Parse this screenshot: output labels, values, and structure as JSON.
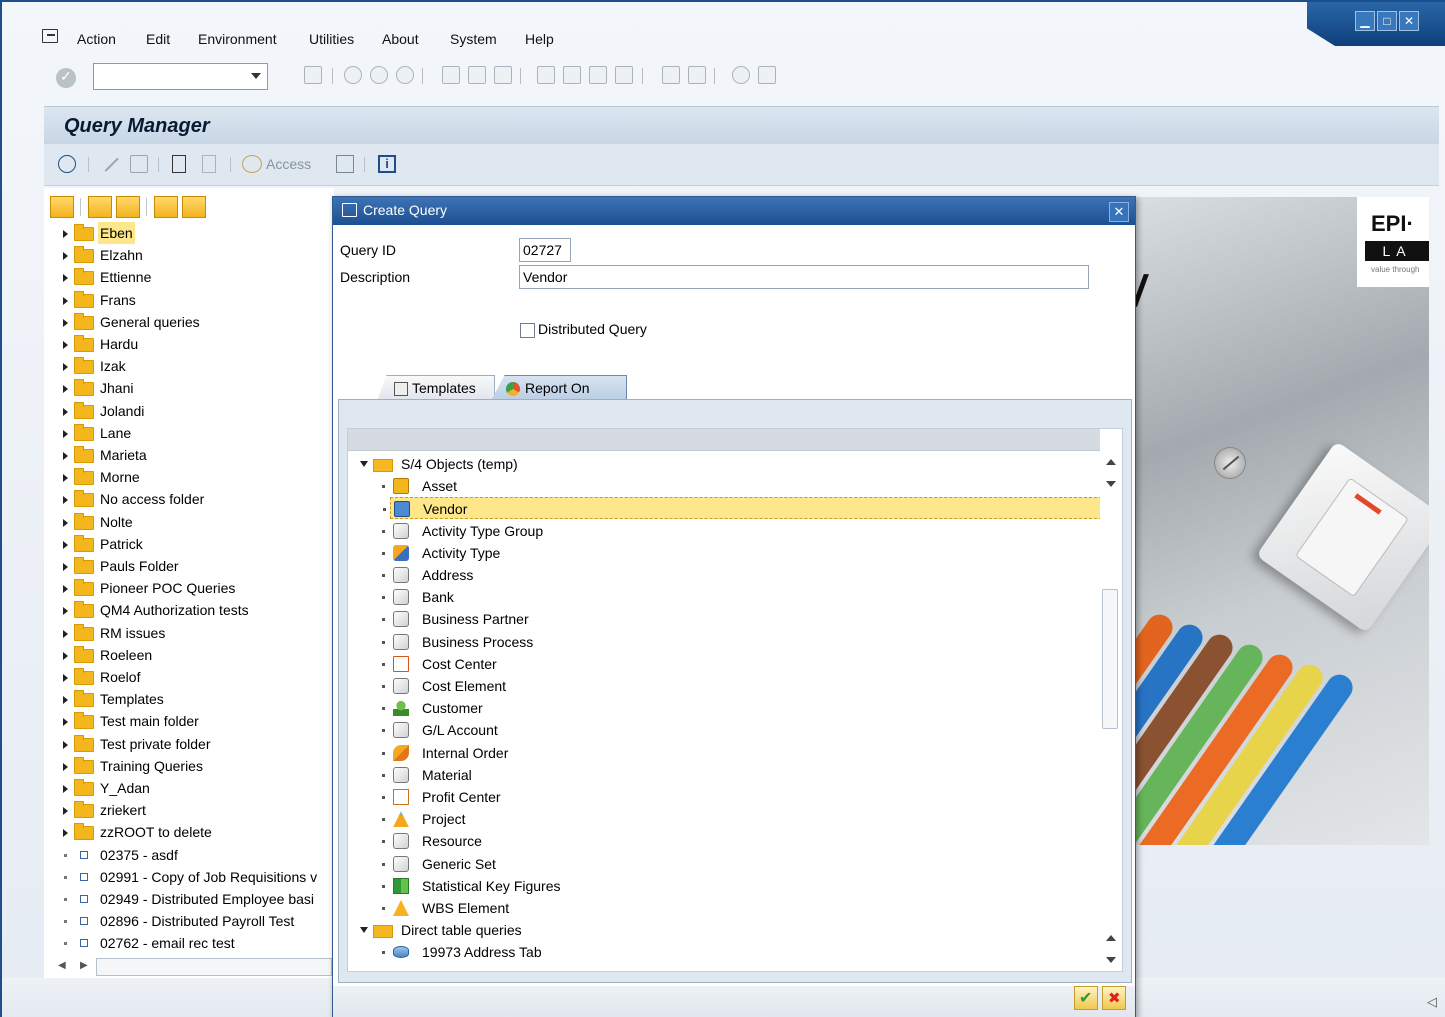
{
  "menubar": {
    "items": [
      "Action",
      "Edit",
      "Environment",
      "Utilities",
      "About",
      "System",
      "Help"
    ]
  },
  "window_controls": [
    "minimize-icon",
    "maximize-icon",
    "close-icon"
  ],
  "query_manager": {
    "title": "Query Manager",
    "toolbar": {
      "access_label": "Access"
    }
  },
  "left_tree": {
    "folders": [
      "Eben",
      "Elzahn",
      "Ettienne",
      "Frans",
      "General queries",
      "Hardu",
      "Izak",
      "Jhani",
      "Jolandi",
      "Lane",
      "Marieta",
      "Morne",
      "No access folder",
      "Nolte",
      "Patrick",
      "Pauls Folder",
      "Pioneer POC Queries",
      "QM4 Authorization tests",
      "RM issues",
      "Roeleen",
      "Roelof",
      "Templates",
      "Test main folder",
      "Test private folder",
      "Training Queries",
      "Y_Adan",
      "zriekert",
      "zzROOT to delete"
    ],
    "queries": [
      "02375 - asdf",
      "02991 - Copy of Job Requisitions v",
      "02949 - Distributed Employee basi",
      "02896 - Distributed Payroll Test",
      "02762 - email rec test"
    ],
    "selected": "Eben"
  },
  "dialog": {
    "title": "Create Query",
    "query_id_label": "Query ID",
    "query_id_value": "02727",
    "description_label": "Description",
    "description_value": "Vendor",
    "distributed_label": "Distributed Query",
    "distributed_checked": false,
    "tabs": [
      {
        "label": "Templates",
        "icon": "templates-icon"
      },
      {
        "label": "Report On",
        "icon": "report-on-icon"
      }
    ],
    "active_tab": "Report On",
    "tree": {
      "folder1": "S/4 Objects (temp)",
      "objects": [
        {
          "label": "Asset",
          "icon": "asset-icon"
        },
        {
          "label": "Vendor",
          "icon": "vendor-icon"
        },
        {
          "label": "Activity Type Group",
          "icon": "cube-icon"
        },
        {
          "label": "Activity Type",
          "icon": "activity-type-icon"
        },
        {
          "label": "Address",
          "icon": "cube-icon"
        },
        {
          "label": "Bank",
          "icon": "cube-icon"
        },
        {
          "label": "Business Partner",
          "icon": "cube-icon"
        },
        {
          "label": "Business Process",
          "icon": "cube-icon"
        },
        {
          "label": "Cost Center",
          "icon": "cost-center-icon"
        },
        {
          "label": "Cost Element",
          "icon": "cube-icon"
        },
        {
          "label": "Customer",
          "icon": "customer-icon"
        },
        {
          "label": "G/L Account",
          "icon": "cube-icon"
        },
        {
          "label": "Internal Order",
          "icon": "internal-order-icon"
        },
        {
          "label": "Material",
          "icon": "cube-icon"
        },
        {
          "label": "Profit Center",
          "icon": "profit-center-icon"
        },
        {
          "label": "Project",
          "icon": "project-icon"
        },
        {
          "label": "Resource",
          "icon": "cube-icon"
        },
        {
          "label": "Generic Set",
          "icon": "cube-icon"
        },
        {
          "label": "Statistical Key Figures",
          "icon": "statistical-key-figures-icon"
        },
        {
          "label": "WBS Element",
          "icon": "wbs-element-icon"
        }
      ],
      "folder2": "Direct table queries",
      "sub_item": "19973 Address Tab",
      "selected": "Vendor"
    }
  },
  "logo": {
    "line1": "EPI·",
    "line2": "LA",
    "tagline": "value through"
  }
}
